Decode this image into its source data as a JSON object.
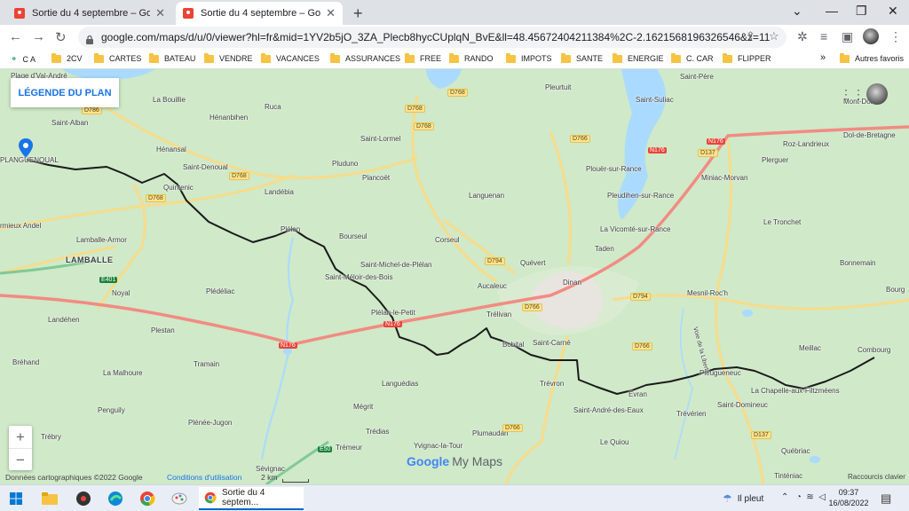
{
  "tabs": [
    {
      "title": "Sortie du 4 septembre – Google My",
      "active": false
    },
    {
      "title": "Sortie du 4 septembre – Google My",
      "active": true
    }
  ],
  "window_controls": {
    "collapse": "⌄",
    "minimize": "—",
    "restore": "❐",
    "close": "✕"
  },
  "url": "google.com/maps/d/u/0/viewer?hl=fr&mid=1YV2b5jO_3ZA_Plecb8hycCUplqN_BvE&ll=48.45672404211384%2C-2.1621568196326546&z=11",
  "bookmarks": [
    {
      "label": "C A",
      "icon": "ca-icon"
    },
    {
      "label": "2CV"
    },
    {
      "label": "CARTES"
    },
    {
      "label": "BATEAU"
    },
    {
      "label": "VENDRE"
    },
    {
      "label": "VACANCES"
    },
    {
      "label": "ASSURANCES"
    },
    {
      "label": "FREE"
    },
    {
      "label": "RANDO"
    },
    {
      "label": "IMPOTS"
    },
    {
      "label": "SANTE"
    },
    {
      "label": "ENERGIE"
    },
    {
      "label": "C. CAR"
    },
    {
      "label": "FLIPPER"
    }
  ],
  "bookmarks_more": "»",
  "bookmarks_other": "Autres favoris",
  "map": {
    "legend_button": "LÉGENDE DU PLAN",
    "zoom_in": "+",
    "zoom_out": "−",
    "places": [
      {
        "name": "Plage d'Val-André",
        "id": "val-andre"
      },
      {
        "name": "La Bouillie",
        "id": "la-bouillie"
      },
      {
        "name": "Ruca",
        "id": "ruca"
      },
      {
        "name": "Pleurtuit",
        "id": "pleurtuit"
      },
      {
        "name": "Saint-Père",
        "id": "saint-pere"
      },
      {
        "name": "Hénanbihen",
        "id": "henanbihen"
      },
      {
        "name": "Saint-Alban",
        "id": "saint-alban"
      },
      {
        "name": "Saint-Suliac",
        "id": "saint-suliac"
      },
      {
        "name": "Mont-Dol",
        "id": "mont-dol"
      },
      {
        "name": "Saint-Lormel",
        "id": "saint-lormel"
      },
      {
        "name": "Dol-de-Bretagne",
        "id": "dol-de-bretagne"
      },
      {
        "name": "Hénansal",
        "id": "henansal"
      },
      {
        "name": "Roz-Landrieux",
        "id": "roz-landrieux"
      },
      {
        "name": "PLANGUENOUAL",
        "id": "planguenoual"
      },
      {
        "name": "Pluduno",
        "id": "pluduno"
      },
      {
        "name": "Saint-Denoual",
        "id": "saint-denoual"
      },
      {
        "name": "Plerguer",
        "id": "plerguer"
      },
      {
        "name": "Plouër-sur-Rance",
        "id": "plouer-sur-rance"
      },
      {
        "name": "Plancoët",
        "id": "plancoet"
      },
      {
        "name": "Miniac-Morvan",
        "id": "miniac-morvan"
      },
      {
        "name": "Quintenic",
        "id": "quintenic"
      },
      {
        "name": "Landébia",
        "id": "landebia"
      },
      {
        "name": "Languenan",
        "id": "languenan"
      },
      {
        "name": "Pleudihen-sur-Rance",
        "id": "pleudihen"
      },
      {
        "name": "Le Tronchet",
        "id": "le-tronchet"
      },
      {
        "name": "rmieux Andel",
        "id": "andel"
      },
      {
        "name": "Plélan",
        "id": "plelan"
      },
      {
        "name": "La Vicomté-sur-Rance",
        "id": "la-vicomte"
      },
      {
        "name": "Bourseul",
        "id": "bourseul"
      },
      {
        "name": "Corseul",
        "id": "corseul"
      },
      {
        "name": "Lamballe-Armor",
        "id": "lamballe-armor"
      },
      {
        "name": "Taden",
        "id": "taden"
      },
      {
        "name": "Bonnemain",
        "id": "bonnemain"
      },
      {
        "name": "LAMBALLE",
        "id": "lamballe",
        "big": true
      },
      {
        "name": "Saint-Michel-de-Plélan",
        "id": "saint-michel"
      },
      {
        "name": "Quévert",
        "id": "quevert"
      },
      {
        "name": "Dinan",
        "id": "dinan"
      },
      {
        "name": "Saint-Méloir-des-Bois",
        "id": "saint-meloir"
      },
      {
        "name": "Aucaleuc",
        "id": "aucaleuc"
      },
      {
        "name": "Noyal",
        "id": "noyal"
      },
      {
        "name": "Plédéliac",
        "id": "plediac"
      },
      {
        "name": "Mesnil-Roc'h",
        "id": "mesnil-roch"
      },
      {
        "name": "Bourg",
        "id": "bourg"
      },
      {
        "name": "Landéhen",
        "id": "landehen"
      },
      {
        "name": "Plélan-le-Petit",
        "id": "plelan-le-petit"
      },
      {
        "name": "Trélivan",
        "id": "trelivan"
      },
      {
        "name": "Plestan",
        "id": "plestan"
      },
      {
        "name": "Bobital",
        "id": "bobital"
      },
      {
        "name": "Saint-Carné",
        "id": "saint-carne"
      },
      {
        "name": "Meillac",
        "id": "meillac"
      },
      {
        "name": "Bréhand",
        "id": "brehand"
      },
      {
        "name": "Tramain",
        "id": "tramain"
      },
      {
        "name": "Combourg",
        "id": "combourg"
      },
      {
        "name": "La Malhoure",
        "id": "la-malhoure"
      },
      {
        "name": "Pleugueneuc",
        "id": "pleugueneuc"
      },
      {
        "name": "Languédias",
        "id": "languedias"
      },
      {
        "name": "Trévron",
        "id": "trevron"
      },
      {
        "name": "Évran",
        "id": "evran"
      },
      {
        "name": "La Chapelle-aux-Filtzméens",
        "id": "la-chapelle"
      },
      {
        "name": "Penguily",
        "id": "penguily"
      },
      {
        "name": "Mégrit",
        "id": "megrit"
      },
      {
        "name": "Saint-André-des-Eaux",
        "id": "saint-andre"
      },
      {
        "name": "Saint-Domineuc",
        "id": "saint-domineuc"
      },
      {
        "name": "Trévérien",
        "id": "treverien"
      },
      {
        "name": "Plénée-Jugon",
        "id": "plenee-jugon"
      },
      {
        "name": "Trédias",
        "id": "tredias"
      },
      {
        "name": "Plumaudan",
        "id": "plumaudan"
      },
      {
        "name": "Le Quiou",
        "id": "le-quiou"
      },
      {
        "name": "Trébry",
        "id": "trebry"
      },
      {
        "name": "Yvignac-la-Tour",
        "id": "yvignac"
      },
      {
        "name": "Québriac",
        "id": "quebriac"
      },
      {
        "name": "Trémeur",
        "id": "tremeur"
      },
      {
        "name": "Sévignac",
        "id": "sevignac"
      },
      {
        "name": "Tinténiac",
        "id": "tinteniac"
      },
      {
        "name": "Voie de la Liberté",
        "id": "voie-liberte"
      }
    ],
    "road_labels": [
      {
        "text": "D786",
        "color": "yellow"
      },
      {
        "text": "D768",
        "color": "yellow"
      },
      {
        "text": "D768",
        "color": "yellow"
      },
      {
        "text": "D768",
        "color": "yellow"
      },
      {
        "text": "D768",
        "color": "yellow"
      },
      {
        "text": "D768",
        "color": "yellow"
      },
      {
        "text": "D766",
        "color": "yellow"
      },
      {
        "text": "N176",
        "color": "red"
      },
      {
        "text": "N176",
        "color": "red"
      },
      {
        "text": "D137",
        "color": "yellow"
      },
      {
        "text": "D794",
        "color": "yellow"
      },
      {
        "text": "D794",
        "color": "yellow"
      },
      {
        "text": "D766",
        "color": "yellow"
      },
      {
        "text": "E401",
        "color": "green"
      },
      {
        "text": "N176",
        "color": "red"
      },
      {
        "text": "N176",
        "color": "red"
      },
      {
        "text": "D766",
        "color": "yellow"
      },
      {
        "text": "D137",
        "color": "yellow"
      },
      {
        "text": "E50",
        "color": "green"
      },
      {
        "text": "D766",
        "color": "yellow"
      }
    ],
    "attribution": "Données cartographiques ©2022 Google",
    "terms": "Conditions d'utilisation",
    "scale": "2 km",
    "shortcuts": "Raccourcis clavier",
    "logo_google": "Google",
    "logo_mymaps": "My Maps",
    "route_color": "#1a1a1a",
    "pin_color": "#1a73e8"
  },
  "taskbar": {
    "active_app": "Sortie du 4 septem...",
    "weather": "Il pleut",
    "time": "09:37",
    "date": "16/08/2022"
  }
}
